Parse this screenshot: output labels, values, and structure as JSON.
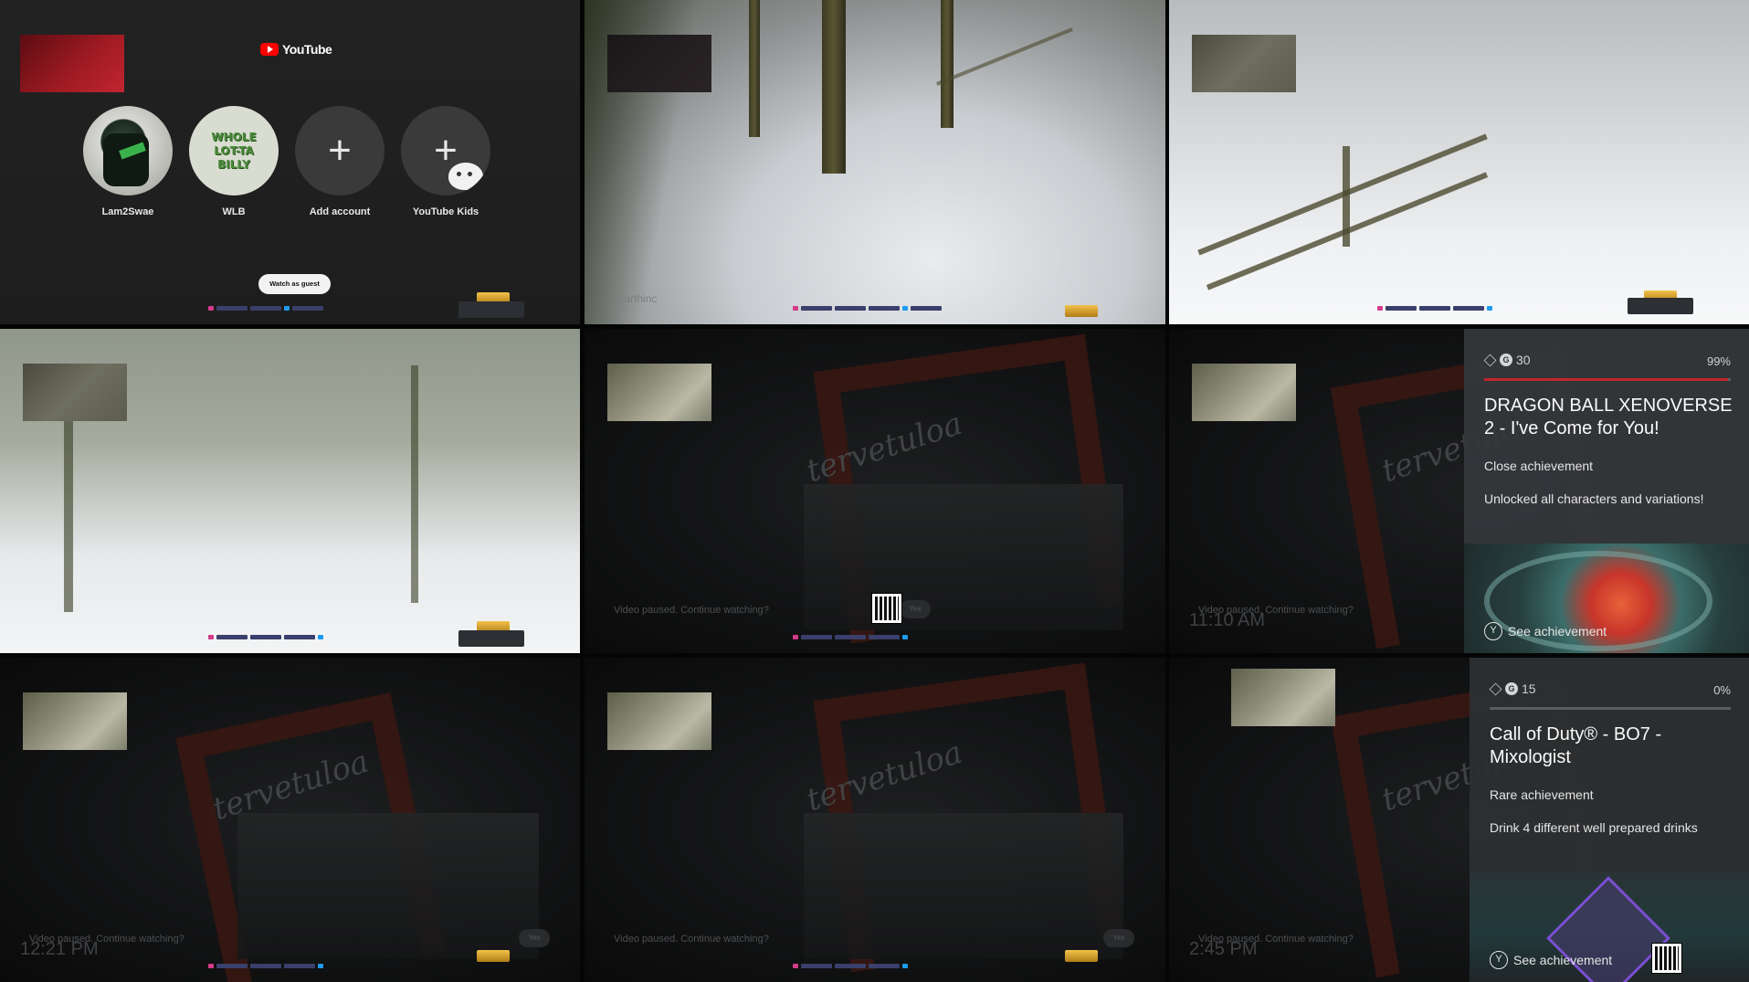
{
  "youtube": {
    "brand": "YouTube",
    "profiles": [
      {
        "name": "Lam2Swae",
        "avatar_icon": "user-photo-avatar"
      },
      {
        "name": "WLB",
        "avatar_text": "WHOLE LOT-TA BILLY"
      },
      {
        "name": "Add account",
        "icon": "plus-icon"
      },
      {
        "name": "YouTube Kids",
        "icon": "plus-icon"
      }
    ],
    "guest_button": "Watch as guest"
  },
  "watermark": "2earthinc",
  "pause_prompt": "Video paused. Continue watching?",
  "yes_label": "Yes",
  "clocks": {
    "t6": "11:10 AM",
    "t7": "12:21 PM",
    "t9": "2:45 PM"
  },
  "graffiti": "tervetuloa",
  "achievements": [
    {
      "gamerscore": "30",
      "percent": "99%",
      "progress": 0.99,
      "title": "DRAGON BALL XENOVERSE 2 - I've Come for You!",
      "kind": "Close achievement",
      "description": "Unlocked all characters and variations!",
      "see": "See achievement",
      "button": "Y"
    },
    {
      "gamerscore": "15",
      "percent": "0%",
      "progress": 0.0,
      "title": "Call of Duty® - BO7 - Mixologist",
      "kind": "Rare achievement",
      "description": "Drink 4 different well prepared drinks",
      "see": "See achievement",
      "button": "Y"
    }
  ],
  "colors": {
    "youtube_red": "#ff0000",
    "progress_red": "#c0262d",
    "panel_bg": "#34373a"
  }
}
